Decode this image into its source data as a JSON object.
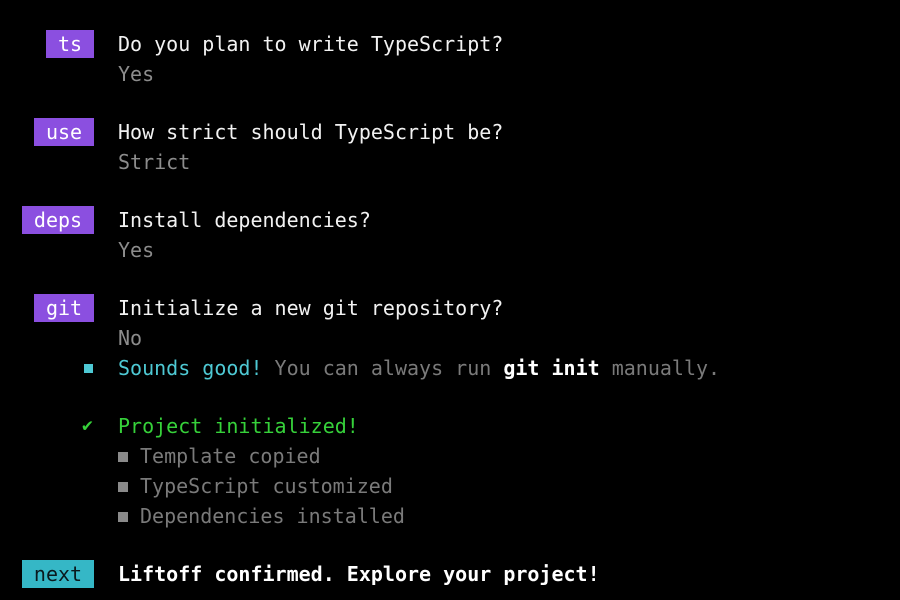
{
  "steps": [
    {
      "badge": "ts",
      "question": "Do you plan to write TypeScript?",
      "answer": "Yes"
    },
    {
      "badge": "use",
      "question": "How strict should TypeScript be?",
      "answer": "Strict"
    },
    {
      "badge": "deps",
      "question": "Install dependencies?",
      "answer": "Yes"
    },
    {
      "badge": "git",
      "question": "Initialize a new git repository?",
      "answer": "No"
    }
  ],
  "git_note": {
    "highlight": "Sounds good!",
    "text_before": "You can always run",
    "command": "git init",
    "text_after": "manually."
  },
  "init": {
    "check_glyph": "✔",
    "title": "Project initialized!",
    "items": [
      "Template copied",
      "TypeScript customized",
      "Dependencies installed"
    ]
  },
  "next": {
    "badge": "next",
    "message": "Liftoff confirmed. Explore your project!"
  },
  "colors": {
    "badge_purple": "#8b4fe0",
    "badge_teal": "#35b7c6",
    "success_green": "#36d13a",
    "info_cyan": "#4ec9d4"
  }
}
